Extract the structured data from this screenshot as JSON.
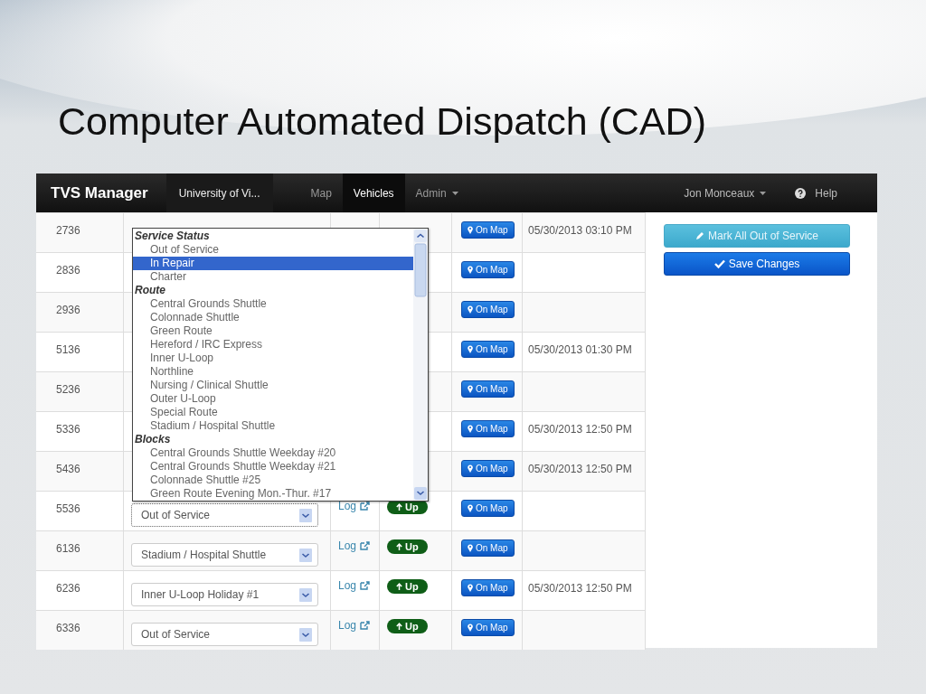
{
  "slide": {
    "title": "Computer Automated Dispatch (CAD)"
  },
  "navbar": {
    "brand": "TVS Manager",
    "organization": "University of Vi...",
    "items": [
      {
        "label": "Map",
        "selected": false,
        "dropdown": false
      },
      {
        "label": "Vehicles",
        "selected": true,
        "dropdown": false
      },
      {
        "label": "Admin",
        "selected": false,
        "dropdown": true
      }
    ],
    "user": "Jon Monceaux",
    "help": "Help"
  },
  "rows": [
    {
      "vehicle": "2736",
      "dropdown_open": true,
      "map_button": "On Map",
      "last_update": "05/30/2013 03:10 PM"
    },
    {
      "vehicle": "2836",
      "map_button": "On Map"
    },
    {
      "vehicle": "2936",
      "map_button": "On Map"
    },
    {
      "vehicle": "5136",
      "map_button": "On Map",
      "last_update": "05/30/2013 01:30 PM"
    },
    {
      "vehicle": "5236",
      "map_button": "On Map"
    },
    {
      "vehicle": "5336",
      "map_button": "On Map",
      "last_update": "05/30/2013 12:50 PM"
    },
    {
      "vehicle": "5436",
      "map_button": "On Map",
      "last_update": "05/30/2013 12:50 PM"
    },
    {
      "vehicle": "5536",
      "status": "Out of Service",
      "focused": true,
      "log": "Log",
      "state": "Up",
      "map_button": "On Map"
    },
    {
      "vehicle": "6136",
      "status": "Stadium / Hospital Shuttle",
      "focused": false,
      "log": "Log",
      "state": "Up",
      "map_button": "On Map"
    },
    {
      "vehicle": "6236",
      "status": "Inner U-Loop Holiday #1",
      "focused": false,
      "log": "Log",
      "state": "Up",
      "map_button": "On Map",
      "last_update": "05/30/2013 12:50 PM"
    },
    {
      "vehicle": "6336",
      "status": "Out of Service",
      "focused": false,
      "log": "Log",
      "state": "Up",
      "map_button": "On Map"
    }
  ],
  "dropdown_list": [
    {
      "group": "Service Status",
      "options": [
        {
          "label": "Out of Service",
          "selected": false
        },
        {
          "label": "In Repair",
          "selected": true
        },
        {
          "label": "Charter",
          "selected": false
        }
      ]
    },
    {
      "group": "Route",
      "options": [
        {
          "label": "Central Grounds Shuttle",
          "selected": false
        },
        {
          "label": "Colonnade Shuttle",
          "selected": false
        },
        {
          "label": "Green Route",
          "selected": false
        },
        {
          "label": "Hereford / IRC Express",
          "selected": false
        },
        {
          "label": "Inner U-Loop",
          "selected": false
        },
        {
          "label": "Northline",
          "selected": false
        },
        {
          "label": "Nursing / Clinical Shuttle",
          "selected": false
        },
        {
          "label": "Outer U-Loop",
          "selected": false
        },
        {
          "label": "Special Route",
          "selected": false
        },
        {
          "label": "Stadium / Hospital Shuttle",
          "selected": false
        }
      ]
    },
    {
      "group": "Blocks",
      "options": [
        {
          "label": "Central Grounds Shuttle Weekday #20",
          "selected": false
        },
        {
          "label": "Central Grounds Shuttle Weekday #21",
          "selected": false
        },
        {
          "label": "Colonnade Shuttle #25",
          "selected": false
        },
        {
          "label": "Green Route Evening Mon.-Thur. #17",
          "selected": false
        }
      ]
    }
  ],
  "actions": [
    {
      "kind": "info",
      "label": "Mark All Out of Service"
    },
    {
      "kind": "primary",
      "label": "Save Changes"
    }
  ]
}
